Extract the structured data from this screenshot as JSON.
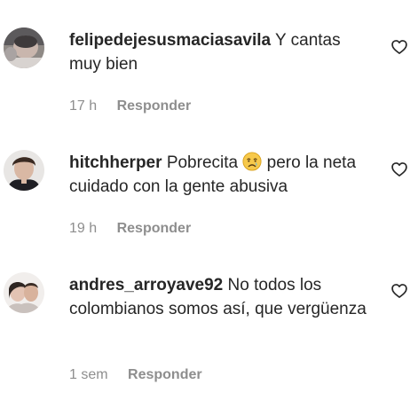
{
  "comments": [
    {
      "username": "felipedejesusmaciasavila",
      "text_before": "Y cantas muy bien",
      "emoji": "",
      "text_after": "",
      "time": "17 h",
      "reply_label": "Responder",
      "avatar_icon": "user-avatar",
      "like_icon": "heart-outline-icon"
    },
    {
      "username": "hitchherper",
      "text_before": "Pobrecita",
      "emoji": "crying-face-emoji",
      "text_after": "pero la neta cuidado con la gente abusiva",
      "time": "19 h",
      "reply_label": "Responder",
      "avatar_icon": "user-avatar",
      "like_icon": "heart-outline-icon"
    },
    {
      "username": "andres_arroyave92",
      "text_before": "No todos los colombianos somos así, que vergüenza",
      "emoji": "",
      "text_after": "",
      "time": "1 sem",
      "reply_label": "Responder",
      "avatar_icon": "user-avatar",
      "like_icon": "heart-outline-icon"
    }
  ],
  "colors": {
    "text": "#262626",
    "secondary": "#8e8e8e",
    "background": "#ffffff"
  }
}
